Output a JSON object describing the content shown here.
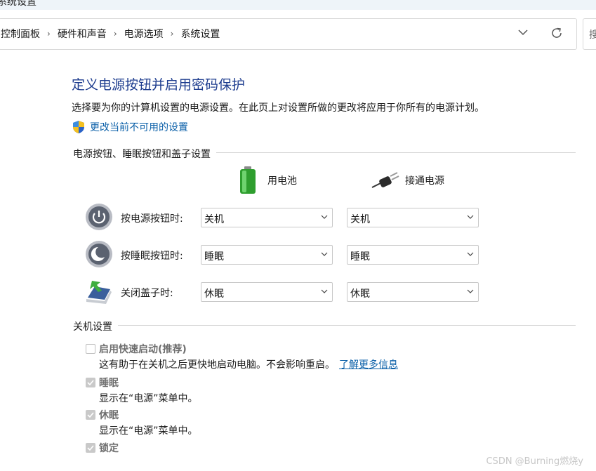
{
  "window": {
    "title": "系统设置"
  },
  "address_bar": {
    "breadcrumbs": [
      "控制面板",
      "硬件和声音",
      "电源选项",
      "系统设置"
    ],
    "search_placeholder": "搜"
  },
  "main": {
    "title": "定义电源按钮并启用密码保护",
    "description": "选择要为你的计算机设置的电源设置。在此页上对设置所做的更改将应用于你所有的电源计划。",
    "change_link": "更改当前不可用的设置",
    "power_group": {
      "title": "电源按钮、睡眠按钮和盖子设置",
      "col_battery": "用电池",
      "col_plugged": "接通电源",
      "rows": [
        {
          "label": "按电源按钮时:",
          "battery": "关机",
          "plugged": "关机",
          "icon": "power-button-icon"
        },
        {
          "label": "按睡眠按钮时:",
          "battery": "睡眠",
          "plugged": "睡眠",
          "icon": "sleep-button-icon"
        },
        {
          "label": "关闭盖子时:",
          "battery": "休眠",
          "plugged": "休眠",
          "icon": "laptop-lid-icon"
        }
      ]
    },
    "shutdown_group": {
      "title": "关机设置",
      "items": [
        {
          "label": "启用快速启动(推荐)",
          "checked": false,
          "desc": "这有助于在关机之后更快地启动电脑。不会影响重启。",
          "link": "了解更多信息"
        },
        {
          "label": "睡眠",
          "checked": true,
          "desc": "显示在“电源”菜单中。"
        },
        {
          "label": "休眠",
          "checked": true,
          "desc": "显示在“电源”菜单中。"
        },
        {
          "label": "锁定",
          "checked": true,
          "desc": ""
        }
      ]
    }
  },
  "watermark": "CSDN @Burning燃烧y",
  "colors": {
    "title": "#1e3d8f",
    "link": "#0a5fa8"
  }
}
